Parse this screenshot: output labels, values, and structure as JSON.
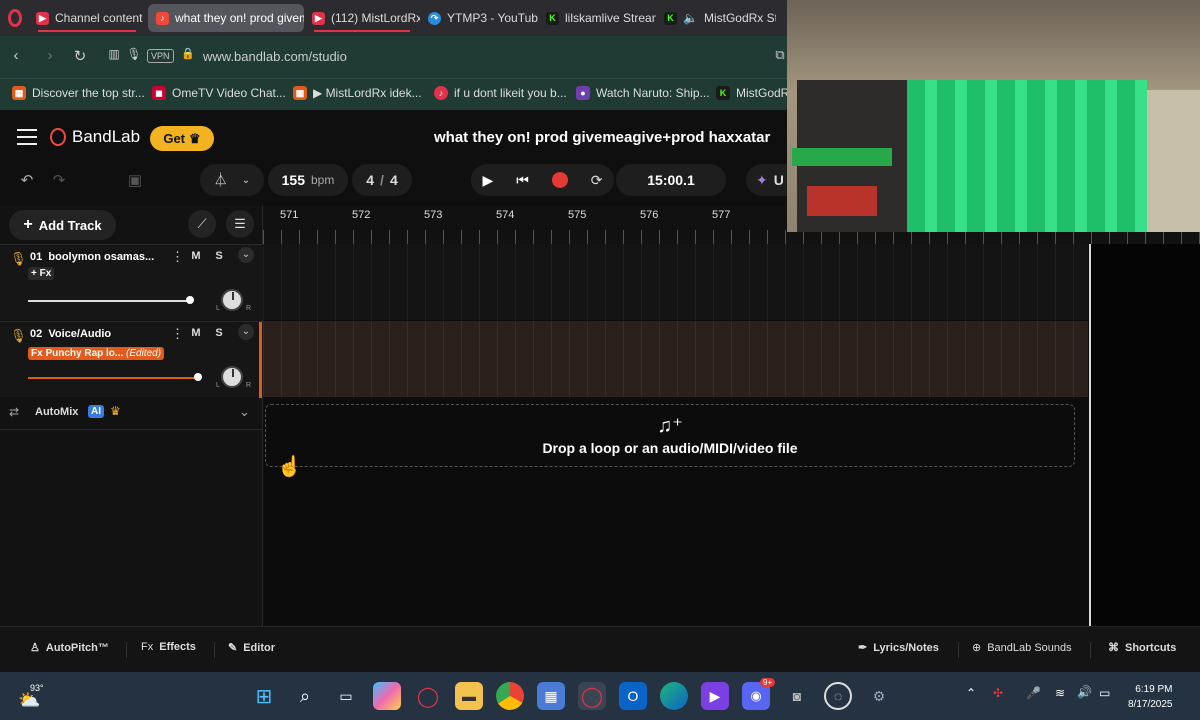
{
  "browser": {
    "tabs": [
      {
        "label": "Channel content",
        "icon": "youtube-icon",
        "color": "#e0334b"
      },
      {
        "label": "what they on! prod givem",
        "icon": "bandlab-icon",
        "color": "#f3483a",
        "active": true
      },
      {
        "label": "(112) MistLordRx",
        "icon": "youtube-icon",
        "color": "#e0334b"
      },
      {
        "label": "YTMP3 - YouTube",
        "icon": "ytmp3-icon",
        "color": "#2b8cdd"
      },
      {
        "label": "lilskamlive Stream",
        "icon": "kick-icon",
        "color": "#53fc18"
      },
      {
        "label": "MistGodRx St",
        "icon": "kick-icon",
        "color": "#53fc18"
      }
    ],
    "vpn_label": "VPN",
    "url": "www.bandlab.com/studio",
    "bookmarks": [
      {
        "label": "Discover the top str...",
        "color": "#e35b1c"
      },
      {
        "label": "OmeTV Video Chat...",
        "color": "#c03"
      },
      {
        "label": "▶ MistLordRx idek...",
        "color": "#e35b1c"
      },
      {
        "label": "if u dont likeit you b...",
        "color": "#e0334b"
      },
      {
        "label": "Watch Naruto: Ship...",
        "color": "#6f3fb0"
      },
      {
        "label": "MistGodRx",
        "color": "#53fc18"
      }
    ]
  },
  "app": {
    "brand": "BandLab",
    "get_label": "Get",
    "project_title": "what they on! prod givemeagive+prod haxxatar",
    "accent": "#f3b21f"
  },
  "transport": {
    "bpm": "155",
    "bpm_unit": "bpm",
    "time_sig_num": "4",
    "time_sig_sep": "/",
    "time_sig_den": "4",
    "time": "15:00.1",
    "partial_label": "U"
  },
  "left": {
    "add_track_label": "Add Track",
    "tracks": [
      {
        "number": "01",
        "name": "boolymon osamas...",
        "m": "M",
        "s": "S",
        "fx": "+ Fx"
      },
      {
        "number": "02",
        "name": "Voice/Audio",
        "m": "M",
        "s": "S",
        "fx": "Fx Punchy Rap lo...",
        "fx_edited": "(Edited)"
      }
    ],
    "pan_l": "L",
    "pan_r": "R",
    "automix_label": "AutoMix",
    "automix_badge": "AI"
  },
  "ruler": [
    "571",
    "572",
    "573",
    "574",
    "575",
    "576",
    "577"
  ],
  "dropzone": {
    "text": "Drop a loop or an audio/MIDI/video file"
  },
  "bottom": {
    "autopitch": "AutoPitch™",
    "effects_prefix": "Fx",
    "effects": "Effects",
    "editor": "Editor",
    "lyrics": "Lyrics/Notes",
    "sounds": "BandLab Sounds",
    "shortcuts": "Shortcuts"
  },
  "taskbar": {
    "weather": "93°",
    "time": "6:19 PM",
    "date": "8/17/2025",
    "discord_badge": "9+"
  }
}
